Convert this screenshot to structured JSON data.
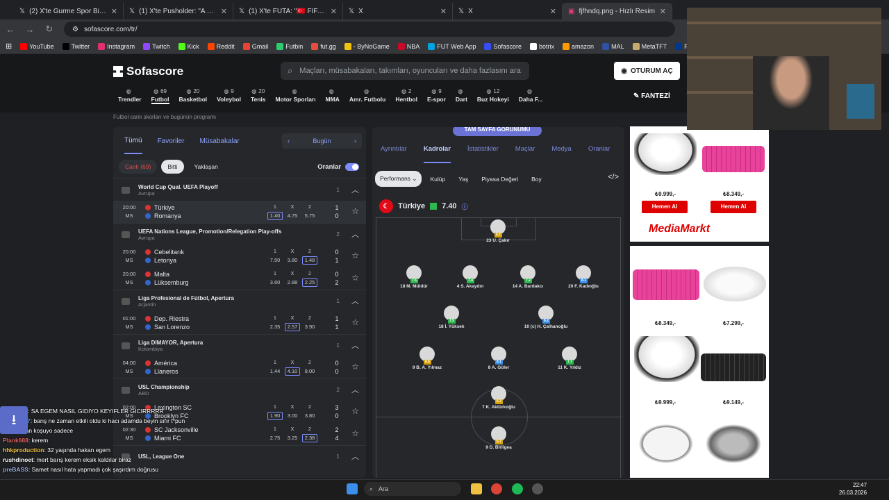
{
  "browser": {
    "tabs": [
      {
        "title": "(2) X'te Gurme Spor Bilgileri: \"ne"
      },
      {
        "title": "(1) X'te Pusholder: \"A Milli Takım"
      },
      {
        "title": "(1) X'te FUTA: \"🇹🇷 FIFA, Dün"
      },
      {
        "title": "X"
      },
      {
        "title": "X"
      },
      {
        "title": "fjfhndq.png - Hızlı Resim"
      }
    ],
    "url": "sofascore.com/tr/",
    "bookmarks": [
      {
        "label": "YouTube",
        "color": "#ff0000"
      },
      {
        "label": "Twitter",
        "color": "#000"
      },
      {
        "label": "Instagram",
        "color": "#e1306c"
      },
      {
        "label": "Twitch",
        "color": "#9146ff"
      },
      {
        "label": "Kick",
        "color": "#53fc18"
      },
      {
        "label": "Reddit",
        "color": "#ff4500"
      },
      {
        "label": "Gmail",
        "color": "#ea4335"
      },
      {
        "label": "Futbin",
        "color": "#2ecc71"
      },
      {
        "label": "fut.gg",
        "color": "#e74c3c"
      },
      {
        "label": "- ByNoGame",
        "color": "#f1c40f"
      },
      {
        "label": "NBA",
        "color": "#c9082a"
      },
      {
        "label": "FUT Web App",
        "color": "#00a3e0"
      },
      {
        "label": "Sofascore",
        "color": "#374df5"
      },
      {
        "label": "botrix",
        "color": "#fff"
      },
      {
        "label": "amazon",
        "color": "#ff9900"
      },
      {
        "label": "MAL",
        "color": "#2e51a2"
      },
      {
        "label": "MetaTFT",
        "color": "#c8aa6e"
      },
      {
        "label": "PSNProfiles",
        "color": "#003791"
      }
    ]
  },
  "header": {
    "logo": "Sofascore",
    "search_placeholder": "Maçları, müsabakaları, takımları, oyuncuları ve daha fazlasını ara",
    "login": "OTURUM AÇ",
    "fantasy": "FANTEZİ",
    "subtitle": "Futbol canlı skorları ve bugünün programı"
  },
  "sports": [
    {
      "name": "Trendler",
      "count": ""
    },
    {
      "name": "Futbol",
      "count": "69"
    },
    {
      "name": "Basketbol",
      "count": "20"
    },
    {
      "name": "Voleybol",
      "count": "9"
    },
    {
      "name": "Tenis",
      "count": "20"
    },
    {
      "name": "Motor Sporları",
      "count": ""
    },
    {
      "name": "MMA",
      "count": ""
    },
    {
      "name": "Amr. Futbolu",
      "count": ""
    },
    {
      "name": "Hentbol",
      "count": "2"
    },
    {
      "name": "E-spor",
      "count": "9"
    },
    {
      "name": "Dart",
      "count": ""
    },
    {
      "name": "Buz Hokeyi",
      "count": "12"
    },
    {
      "name": "Daha F...",
      "count": ""
    }
  ],
  "left": {
    "tabs": [
      "Tümü",
      "Favoriler",
      "Müsabakalar"
    ],
    "date": "Bugün",
    "filters": {
      "live": "Canlı (69)",
      "finished": "Bitti",
      "upcoming": "Yaklaşan"
    },
    "odds_label": "Oranlar",
    "leagues": [
      {
        "name": "World Cup Qual. UEFA Playoff",
        "country": "Avrupa",
        "count": "1",
        "matches": [
          {
            "time": "20:00",
            "status": "MS",
            "home": "Türkiye",
            "away": "Romanya",
            "o1": "1.40",
            "ox": "4.75",
            "o2": "5.75",
            "hs": "1",
            "as": "0"
          }
        ]
      },
      {
        "name": "UEFA Nations League, Promotion/Relegation Play-offs",
        "country": "Avrupa",
        "count": "2",
        "matches": [
          {
            "time": "20:00",
            "status": "MS",
            "home": "Cebelitarık",
            "away": "Letonya",
            "o1": "7.50",
            "ox": "3.80",
            "o2": "1.48",
            "hs": "0",
            "as": "1"
          },
          {
            "time": "20:00",
            "status": "MS",
            "home": "Malta",
            "away": "Lüksemburg",
            "o1": "3.60",
            "ox": "2.88",
            "o2": "2.25",
            "hs": "0",
            "as": "2"
          }
        ]
      },
      {
        "name": "Liga Profesional de Fútbol, Apertura",
        "country": "Arjantin",
        "count": "1",
        "matches": [
          {
            "time": "01:00",
            "status": "MS",
            "home": "Dep. Riestra",
            "away": "San Lorenzo",
            "o1": "2.35",
            "ox": "2.57",
            "o2": "3.90",
            "hs": "1",
            "as": "1"
          }
        ]
      },
      {
        "name": "Liga DIMAYOR, Apertura",
        "country": "Kolombiya",
        "count": "1",
        "matches": [
          {
            "time": "04:00",
            "status": "MS",
            "home": "América",
            "away": "Llaneros",
            "o1": "1.44",
            "ox": "4.10",
            "o2": "8.00",
            "hs": "0",
            "as": "0"
          }
        ]
      },
      {
        "name": "USL Championship",
        "country": "ABD",
        "count": "2",
        "matches": [
          {
            "time": "02:00",
            "status": "MS",
            "home": "Lexington SC",
            "away": "Brooklyn FC",
            "o1": "1.90",
            "ox": "3.00",
            "o2": "3.80",
            "hs": "3",
            "as": "0"
          },
          {
            "time": "02:30",
            "status": "MS",
            "home": "SC Jacksonville",
            "away": "Miami FC",
            "o1": "2.75",
            "ox": "3.25",
            "o2": "2.38",
            "hs": "2",
            "as": "4"
          }
        ]
      },
      {
        "name": "USL, League One",
        "country": "",
        "count": "1",
        "matches": []
      }
    ]
  },
  "middle": {
    "full_page": "TAM SAYFA GÖRÜNÜMÜ",
    "tabs": [
      "Ayrıntılar",
      "Kadrolar",
      "İstatistikler",
      "Maçlar",
      "Medya",
      "Oranlar"
    ],
    "filters": [
      "Performans",
      "Kulüp",
      "Yaş",
      "Piyasa Değeri",
      "Boy"
    ],
    "team": "Türkiye",
    "team_rating": "7.40",
    "players": [
      {
        "name": "23 U. Çakır",
        "rating": "6.7"
      },
      {
        "name": "18 M. Müldür",
        "rating": "7.5"
      },
      {
        "name": "4 S. Akaydın",
        "rating": "7.4"
      },
      {
        "name": "14 A. Bardakcı",
        "rating": "7.2"
      },
      {
        "name": "20 F. Kadıoğlu",
        "rating": "8.1"
      },
      {
        "name": "18 İ. Yüksek",
        "rating": "7.5"
      },
      {
        "name": "10 (c) H. Çalhanoğlu",
        "rating": "8.2"
      },
      {
        "name": "9 B. A. Yılmaz",
        "rating": "6.6"
      },
      {
        "name": "8 A. Güler",
        "rating": "8.1"
      },
      {
        "name": "11 K. Yıldız",
        "rating": "7.7"
      },
      {
        "name": "7 K. Aktürkoğlu",
        "rating": "6.7"
      },
      {
        "name": "9 D. Birligea",
        "rating": "6.7"
      }
    ]
  },
  "ads": {
    "ad1": {
      "price1": "₺9.999,-",
      "price2": "₺8.349,-",
      "buy": "Hemen Al",
      "brand": "MediaMarkt"
    },
    "ad2": {
      "p1": "₺8.349,-",
      "p2": "₺7.299,-",
      "p3": "₺9.999,-",
      "p4": "₺9.149,-"
    }
  },
  "chat": [
    {
      "user": "",
      "msg": ": SA EGEM NASIL GIDIYO KEYIFLER GICIRRRRR"
    },
    {
      "user": "shaolinn7",
      "msg": ": barış ne zaman etkili oldu ki hacı adamda beyin sıfır t*pun"
    },
    {
      "user": "",
      "msg": "arkasından koşuyo sadece"
    },
    {
      "user": "Plank688",
      "msg": ": kerem"
    },
    {
      "user": "hhkproduction",
      "msg": ": 32 yaşında hakan egem"
    },
    {
      "user": "rushdinoet",
      "msg": ": mert barış kerem eksik kaldılar biraz"
    },
    {
      "user": "preBASS",
      "msg": ": Samet nasıl hata yapmadı çok şaşırdım doğrusu"
    }
  ],
  "taskbar": {
    "search": "Ara",
    "time": "22:47",
    "date": "26.03.2026"
  }
}
